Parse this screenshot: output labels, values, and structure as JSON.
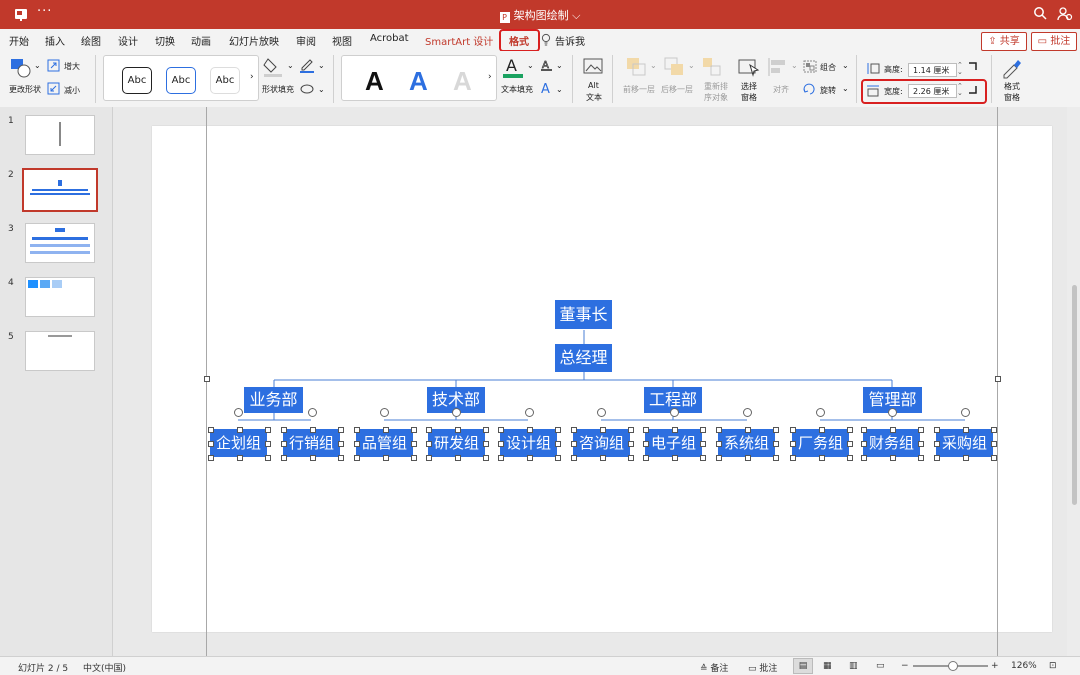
{
  "titlebar": {
    "title": "架构图绘制",
    "more": "···"
  },
  "tabs": [
    "开始",
    "插入",
    "绘图",
    "设计",
    "切换",
    "动画",
    "幻灯片放映",
    "审阅",
    "视图",
    "Acrobat",
    "SmartArt 设计",
    "格式",
    "告诉我"
  ],
  "share_label": "共享",
  "comment_label": "批注",
  "ribbon": {
    "change_shape": "更改形状",
    "grow": "增大",
    "shrink": "减小",
    "shape_styles": [
      "Abc",
      "Abc",
      "Abc"
    ],
    "shape_fill": "形状填充",
    "wordart": [
      "A",
      "A",
      "A"
    ],
    "text_fill": "文本填充",
    "alt_text_1": "Alt",
    "alt_text_2": "文本",
    "bring_forward": "前移一层",
    "send_backward": "后移一层",
    "reorder_1": "重新排",
    "reorder_2": "序对象",
    "selection_pane_1": "选择",
    "selection_pane_2": "窗格",
    "align": "对齐",
    "group": "组合",
    "rotate": "旋转",
    "height_label": "高度:",
    "height_value": "1.14 厘米",
    "width_label": "宽度:",
    "width_value": "2.26 厘米",
    "format_pane_1": "格式",
    "format_pane_2": "窗格"
  },
  "slides": [
    {
      "num": "1"
    },
    {
      "num": "2"
    },
    {
      "num": "3"
    },
    {
      "num": "4"
    },
    {
      "num": "5"
    }
  ],
  "org": {
    "chairman": "董事长",
    "gm": "总经理",
    "departments": [
      "业务部",
      "技术部",
      "工程部",
      "管理部"
    ],
    "groups": [
      "企划组",
      "行销组",
      "品管组",
      "研发组",
      "设计组",
      "咨询组",
      "电子组",
      "系统组",
      "厂务组",
      "财务组",
      "采购组"
    ]
  },
  "status": {
    "slide_info": "幻灯片 2 / 5",
    "language": "中文(中国)",
    "notes": "备注",
    "comments": "批注",
    "zoom": "126%"
  },
  "colors": {
    "accent": "#c1392b",
    "org_box": "#2d6fe0",
    "highlight": "#d82020"
  }
}
